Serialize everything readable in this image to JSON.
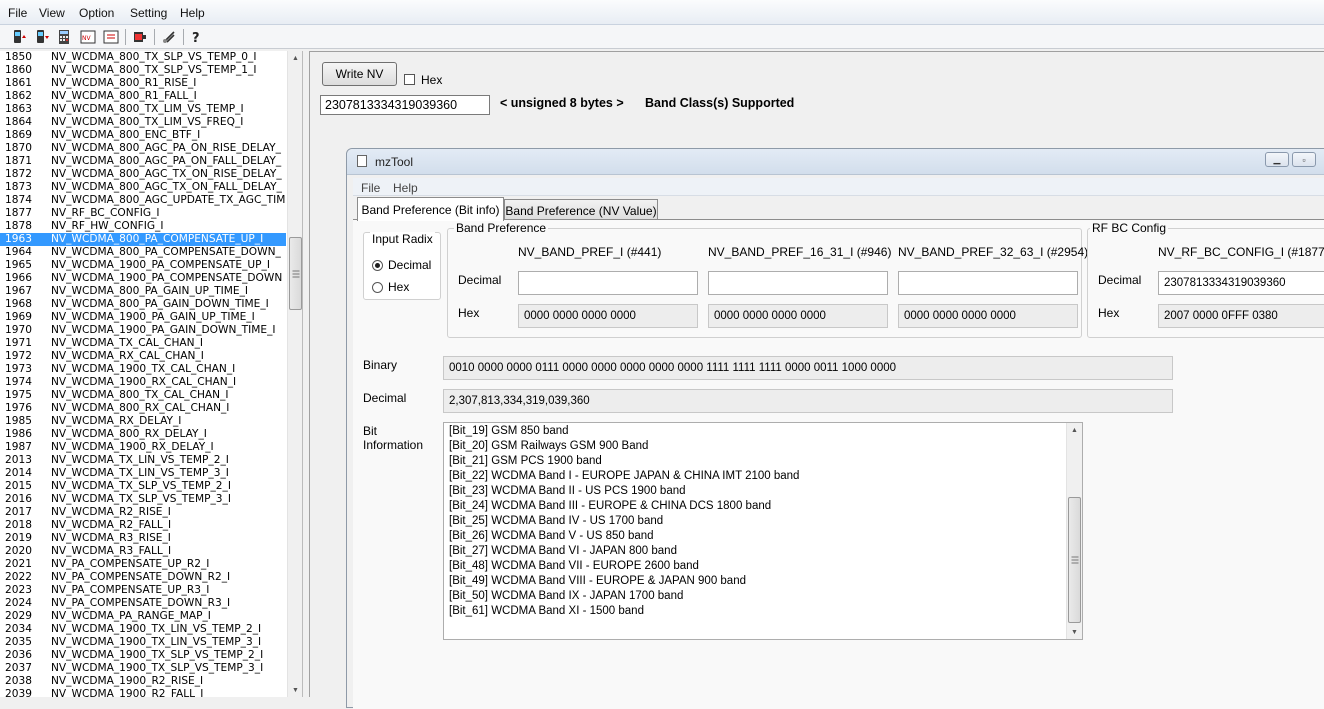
{
  "menubar": {
    "items": [
      "File",
      "View",
      "Option",
      "Setting",
      "Help"
    ]
  },
  "toolbar": {
    "buttons": [
      "read-phone-icon",
      "write-phone-icon",
      "calculator-icon",
      "nv-read-icon",
      "nv-write-icon",
      "battery-icon",
      "connect-icon",
      "help-icon"
    ]
  },
  "nv_list": {
    "selected_index": 14,
    "items": [
      {
        "num": "1850",
        "name": "NV_WCDMA_800_TX_SLP_VS_TEMP_0_I"
      },
      {
        "num": "1860",
        "name": "NV_WCDMA_800_TX_SLP_VS_TEMP_1_I"
      },
      {
        "num": "1861",
        "name": "NV_WCDMA_800_R1_RISE_I"
      },
      {
        "num": "1862",
        "name": "NV_WCDMA_800_R1_FALL_I"
      },
      {
        "num": "1863",
        "name": "NV_WCDMA_800_TX_LIM_VS_TEMP_I"
      },
      {
        "num": "1864",
        "name": "NV_WCDMA_800_TX_LIM_VS_FREQ_I"
      },
      {
        "num": "1869",
        "name": "NV_WCDMA_800_ENC_BTF_I"
      },
      {
        "num": "1870",
        "name": "NV_WCDMA_800_AGC_PA_ON_RISE_DELAY_"
      },
      {
        "num": "1871",
        "name": "NV_WCDMA_800_AGC_PA_ON_FALL_DELAY_"
      },
      {
        "num": "1872",
        "name": "NV_WCDMA_800_AGC_TX_ON_RISE_DELAY_"
      },
      {
        "num": "1873",
        "name": "NV_WCDMA_800_AGC_TX_ON_FALL_DELAY_"
      },
      {
        "num": "1874",
        "name": "NV_WCDMA_800_AGC_UPDATE_TX_AGC_TIM"
      },
      {
        "num": "1877",
        "name": "NV_RF_BC_CONFIG_I"
      },
      {
        "num": "1878",
        "name": "NV_RF_HW_CONFIG_I"
      },
      {
        "num": "1963",
        "name": "NV_WCDMA_800_PA_COMPENSATE_UP_I"
      },
      {
        "num": "1964",
        "name": "NV_WCDMA_800_PA_COMPENSATE_DOWN_"
      },
      {
        "num": "1965",
        "name": "NV_WCDMA_1900_PA_COMPENSATE_UP_I"
      },
      {
        "num": "1966",
        "name": "NV_WCDMA_1900_PA_COMPENSATE_DOWN"
      },
      {
        "num": "1967",
        "name": "NV_WCDMA_800_PA_GAIN_UP_TIME_I"
      },
      {
        "num": "1968",
        "name": "NV_WCDMA_800_PA_GAIN_DOWN_TIME_I"
      },
      {
        "num": "1969",
        "name": "NV_WCDMA_1900_PA_GAIN_UP_TIME_I"
      },
      {
        "num": "1970",
        "name": "NV_WCDMA_1900_PA_GAIN_DOWN_TIME_I"
      },
      {
        "num": "1971",
        "name": "NV_WCDMA_TX_CAL_CHAN_I"
      },
      {
        "num": "1972",
        "name": "NV_WCDMA_RX_CAL_CHAN_I"
      },
      {
        "num": "1973",
        "name": "NV_WCDMA_1900_TX_CAL_CHAN_I"
      },
      {
        "num": "1974",
        "name": "NV_WCDMA_1900_RX_CAL_CHAN_I"
      },
      {
        "num": "1975",
        "name": "NV_WCDMA_800_TX_CAL_CHAN_I"
      },
      {
        "num": "1976",
        "name": "NV_WCDMA_800_RX_CAL_CHAN_I"
      },
      {
        "num": "1985",
        "name": "NV_WCDMA_RX_DELAY_I"
      },
      {
        "num": "1986",
        "name": "NV_WCDMA_800_RX_DELAY_I"
      },
      {
        "num": "1987",
        "name": "NV_WCDMA_1900_RX_DELAY_I"
      },
      {
        "num": "2013",
        "name": "NV_WCDMA_TX_LIN_VS_TEMP_2_I"
      },
      {
        "num": "2014",
        "name": "NV_WCDMA_TX_LIN_VS_TEMP_3_I"
      },
      {
        "num": "2015",
        "name": "NV_WCDMA_TX_SLP_VS_TEMP_2_I"
      },
      {
        "num": "2016",
        "name": "NV_WCDMA_TX_SLP_VS_TEMP_3_I"
      },
      {
        "num": "2017",
        "name": "NV_WCDMA_R2_RISE_I"
      },
      {
        "num": "2018",
        "name": "NV_WCDMA_R2_FALL_I"
      },
      {
        "num": "2019",
        "name": "NV_WCDMA_R3_RISE_I"
      },
      {
        "num": "2020",
        "name": "NV_WCDMA_R3_FALL_I"
      },
      {
        "num": "2021",
        "name": "NV_PA_COMPENSATE_UP_R2_I"
      },
      {
        "num": "2022",
        "name": "NV_PA_COMPENSATE_DOWN_R2_I"
      },
      {
        "num": "2023",
        "name": "NV_PA_COMPENSATE_UP_R3_I"
      },
      {
        "num": "2024",
        "name": "NV_PA_COMPENSATE_DOWN_R3_I"
      },
      {
        "num": "2029",
        "name": "NV_WCDMA_PA_RANGE_MAP_I"
      },
      {
        "num": "2034",
        "name": "NV_WCDMA_1900_TX_LIN_VS_TEMP_2_I"
      },
      {
        "num": "2035",
        "name": "NV_WCDMA_1900_TX_LIN_VS_TEMP_3_I"
      },
      {
        "num": "2036",
        "name": "NV_WCDMA_1900_TX_SLP_VS_TEMP_2_I"
      },
      {
        "num": "2037",
        "name": "NV_WCDMA_1900_TX_SLP_VS_TEMP_3_I"
      },
      {
        "num": "2038",
        "name": "NV_WCDMA_1900_R2_RISE_I"
      },
      {
        "num": "2039",
        "name": "NV_WCDMA_1900_R2_FALL_I"
      }
    ]
  },
  "editor": {
    "write_label": "Write NV",
    "hex_label": "Hex",
    "value": "2307813334319039360",
    "type_text": "< unsigned 8 bytes >",
    "description": "Band Class(s) Supported"
  },
  "window": {
    "title": "mzTool",
    "menu": [
      "File",
      "Help"
    ],
    "tabs": [
      "Band Preference (Bit info)",
      "Band Preference (NV Value)"
    ],
    "input_radix": {
      "title": "Input Radix",
      "options": [
        "Decimal",
        "Hex"
      ],
      "selected": "Decimal"
    },
    "band_pref": {
      "title": "Band Preference",
      "columns": [
        "NV_BAND_PREF_I (#441)",
        "NV_BAND_PREF_16_31_I (#946)",
        "NV_BAND_PREF_32_63_I (#2954)"
      ],
      "decimal_label": "Decimal",
      "hex_label": "Hex",
      "decimal_values": [
        "",
        "",
        ""
      ],
      "hex_values": [
        "0000 0000 0000 0000",
        "0000 0000 0000 0000",
        "0000 0000 0000 0000"
      ]
    },
    "rf_bc": {
      "title": "RF BC Config",
      "column": "NV_RF_BC_CONFIG_I (#1877)",
      "decimal_label": "Decimal",
      "hex_label": "Hex",
      "decimal_value": "2307813334319039360",
      "hex_value": "2007 0000 0FFF 0380"
    },
    "binary_label": "Binary",
    "binary_value": "0010 0000 0000 0111 0000 0000 0000 0000 0000 1111 1111 1111 0000 0011 1000 0000",
    "decimal_label": "Decimal",
    "decimal_value": "2,307,813,334,319,039,360",
    "bit_info_label_1": "Bit",
    "bit_info_label_2": "Information",
    "bit_info": [
      "[Bit_19] GSM 850 band",
      "[Bit_20] GSM Railways GSM 900 Band",
      "[Bit_21] GSM PCS 1900 band",
      "[Bit_22] WCDMA Band I - EUROPE JAPAN & CHINA IMT 2100 band",
      "[Bit_23] WCDMA Band II - US PCS 1900 band",
      "[Bit_24] WCDMA Band III - EUROPE & CHINA DCS 1800 band",
      "[Bit_25] WCDMA Band IV - US 1700 band",
      "[Bit_26] WCDMA Band V - US 850 band",
      "[Bit_27] WCDMA Band VI - JAPAN 800 band",
      "[Bit_48] WCDMA Band VII - EUROPE 2600 band",
      "[Bit_49] WCDMA Band VIII - EUROPE & JAPAN 900 band",
      "[Bit_50] WCDMA Band IX - JAPAN 1700 band",
      "[Bit_61] WCDMA Band XI - 1500 band"
    ]
  }
}
